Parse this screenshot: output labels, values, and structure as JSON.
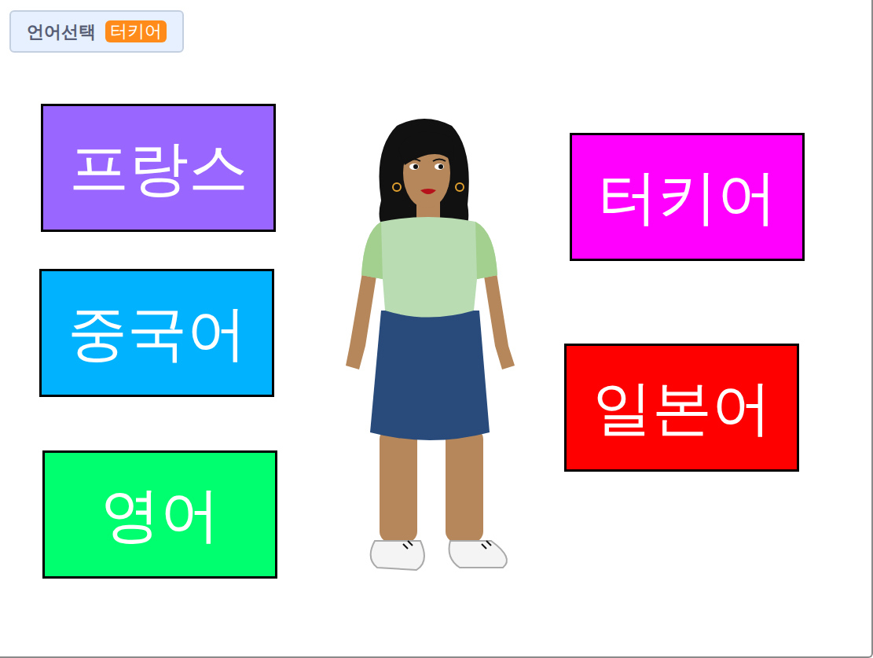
{
  "monitor": {
    "label": "언어선택",
    "value": "터키어"
  },
  "buttons": [
    {
      "label": "프랑스",
      "color": "#9966ff"
    },
    {
      "label": "중국어",
      "color": "#00b2ff"
    },
    {
      "label": "영어",
      "color": "#00ff6e"
    },
    {
      "label": "터키어",
      "color": "#ff00ff"
    },
    {
      "label": "일본어",
      "color": "#ff0000"
    }
  ]
}
